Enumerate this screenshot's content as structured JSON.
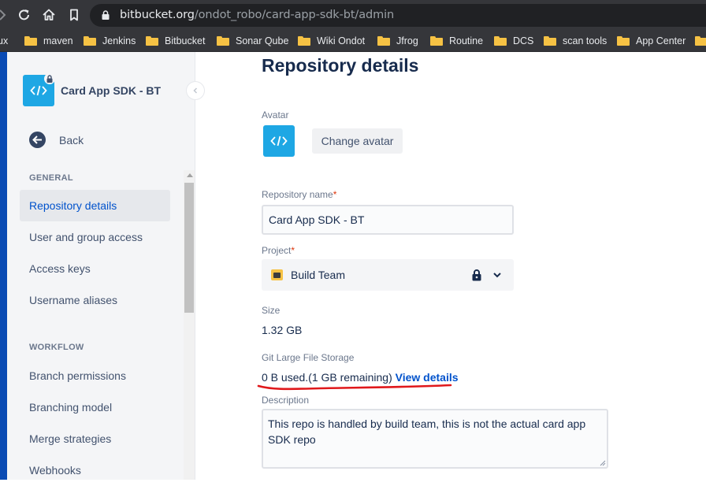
{
  "browser": {
    "url_host": "bitbucket.org",
    "url_path": "/ondot_robo/card-app-sdk-bt/admin",
    "bookmarks": [
      {
        "label": "ux",
        "folder": false
      },
      {
        "label": "maven",
        "folder": true
      },
      {
        "label": "Jenkins",
        "folder": true
      },
      {
        "label": "Bitbucket",
        "folder": true
      },
      {
        "label": "Sonar Qube",
        "folder": true
      },
      {
        "label": "Wiki Ondot",
        "folder": true
      },
      {
        "label": "Jfrog",
        "folder": true
      },
      {
        "label": "Routine",
        "folder": true
      },
      {
        "label": "DCS",
        "folder": true
      },
      {
        "label": "scan tools",
        "folder": true
      },
      {
        "label": "App Center",
        "folder": true
      }
    ]
  },
  "sidebar": {
    "repo_name": "Card App SDK - BT",
    "back_label": "Back",
    "general_heading": "GENERAL",
    "general_items": [
      "Repository details",
      "User and group access",
      "Access keys",
      "Username aliases"
    ],
    "workflow_heading": "WORKFLOW",
    "workflow_items": [
      "Branch permissions",
      "Branching model",
      "Merge strategies",
      "Webhooks"
    ],
    "active_item": "Repository details"
  },
  "main": {
    "title": "Repository details",
    "avatar_label": "Avatar",
    "change_avatar_button": "Change avatar",
    "repo_name_label": "Repository name",
    "required_marker": "*",
    "repo_name_value": "Card App SDK - BT",
    "project_label": "Project",
    "project_value": "Build Team",
    "size_label": "Size",
    "size_value": "1.32 GB",
    "lfs_label": "Git Large File Storage",
    "lfs_usage": "0 B used.(1 GB remaining)",
    "lfs_link": "View details",
    "description_label": "Description",
    "description_value": "This repo is handled by build team, this is not the actual card app SDK repo"
  },
  "colors": {
    "accent": "#0052cc",
    "repo_avatar": "#1ea7e4",
    "annotation": "#e0181b"
  }
}
